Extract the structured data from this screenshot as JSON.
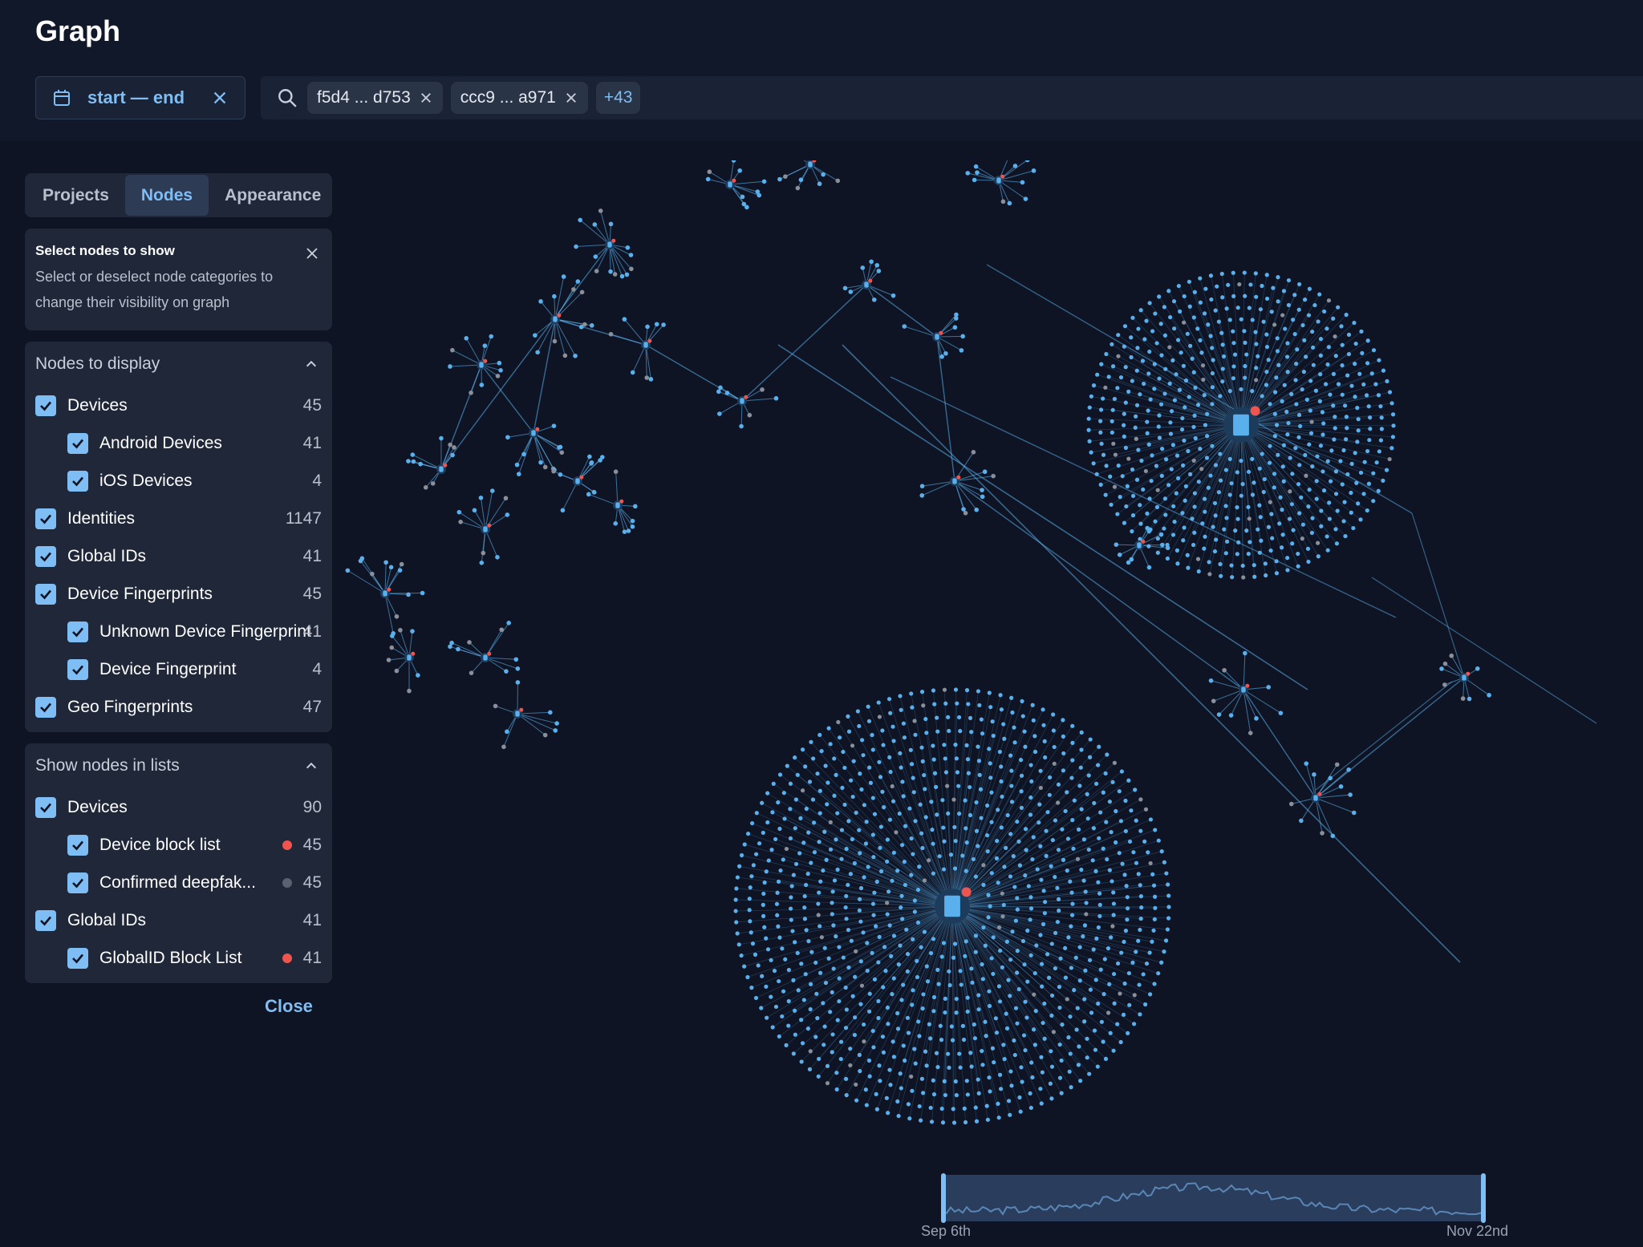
{
  "app": {
    "title": "Graph"
  },
  "date_filter": {
    "label": "start — end",
    "calendar_icon": "calendar-icon",
    "clear_icon": "close-icon"
  },
  "search": {
    "icon": "search-icon",
    "chips": [
      {
        "label": "f5d4 ... d753"
      },
      {
        "label": "ccc9 ... a971"
      }
    ],
    "more_chip": "+43"
  },
  "tabs": [
    {
      "label": "Projects",
      "active": false
    },
    {
      "label": "Nodes",
      "active": true
    },
    {
      "label": "Appearance",
      "active": false
    }
  ],
  "info_box": {
    "heading": "Select nodes to show",
    "description": "Select or deselect node categories to change their visibility on graph"
  },
  "nodes_to_display": {
    "heading": "Nodes to display",
    "items": [
      {
        "label": "Devices",
        "count": "45",
        "checked": true,
        "sub": false
      },
      {
        "label": "Android Devices",
        "count": "41",
        "checked": true,
        "sub": true
      },
      {
        "label": "iOS Devices",
        "count": "4",
        "checked": true,
        "sub": true
      },
      {
        "label": "Identities",
        "count": "1147",
        "checked": true,
        "sub": false
      },
      {
        "label": "Global IDs",
        "count": "41",
        "checked": true,
        "sub": false
      },
      {
        "label": "Device Fingerprints",
        "count": "45",
        "checked": true,
        "sub": false
      },
      {
        "label": "Unknown Device Fingerprint",
        "count": "41",
        "checked": true,
        "sub": true
      },
      {
        "label": "Device Fingerprint",
        "count": "4",
        "checked": true,
        "sub": true
      },
      {
        "label": "Geo Fingerprints",
        "count": "47",
        "checked": true,
        "sub": false
      }
    ]
  },
  "show_in_lists": {
    "heading": "Show nodes in lists",
    "items": [
      {
        "label": "Devices",
        "count": "90",
        "checked": true,
        "sub": false,
        "dot": null
      },
      {
        "label": "Device block list",
        "count": "45",
        "checked": true,
        "sub": true,
        "dot": "#f0544f"
      },
      {
        "label": "Confirmed deepfak...",
        "count": "45",
        "checked": true,
        "sub": true,
        "dot": "#5a6272"
      },
      {
        "label": "Global IDs",
        "count": "41",
        "checked": true,
        "sub": false,
        "dot": null
      },
      {
        "label": "GlobalID Block List",
        "count": "41",
        "checked": true,
        "sub": true,
        "dot": "#f0544f"
      }
    ]
  },
  "close_label": "Close",
  "timeline": {
    "start": "Sep 6th",
    "end": "Nov 22nd"
  },
  "colors": {
    "accent": "#7fbdf5",
    "node_blue": "#5ab0ec",
    "alert_red": "#f0544f",
    "background": "#0f1424"
  }
}
